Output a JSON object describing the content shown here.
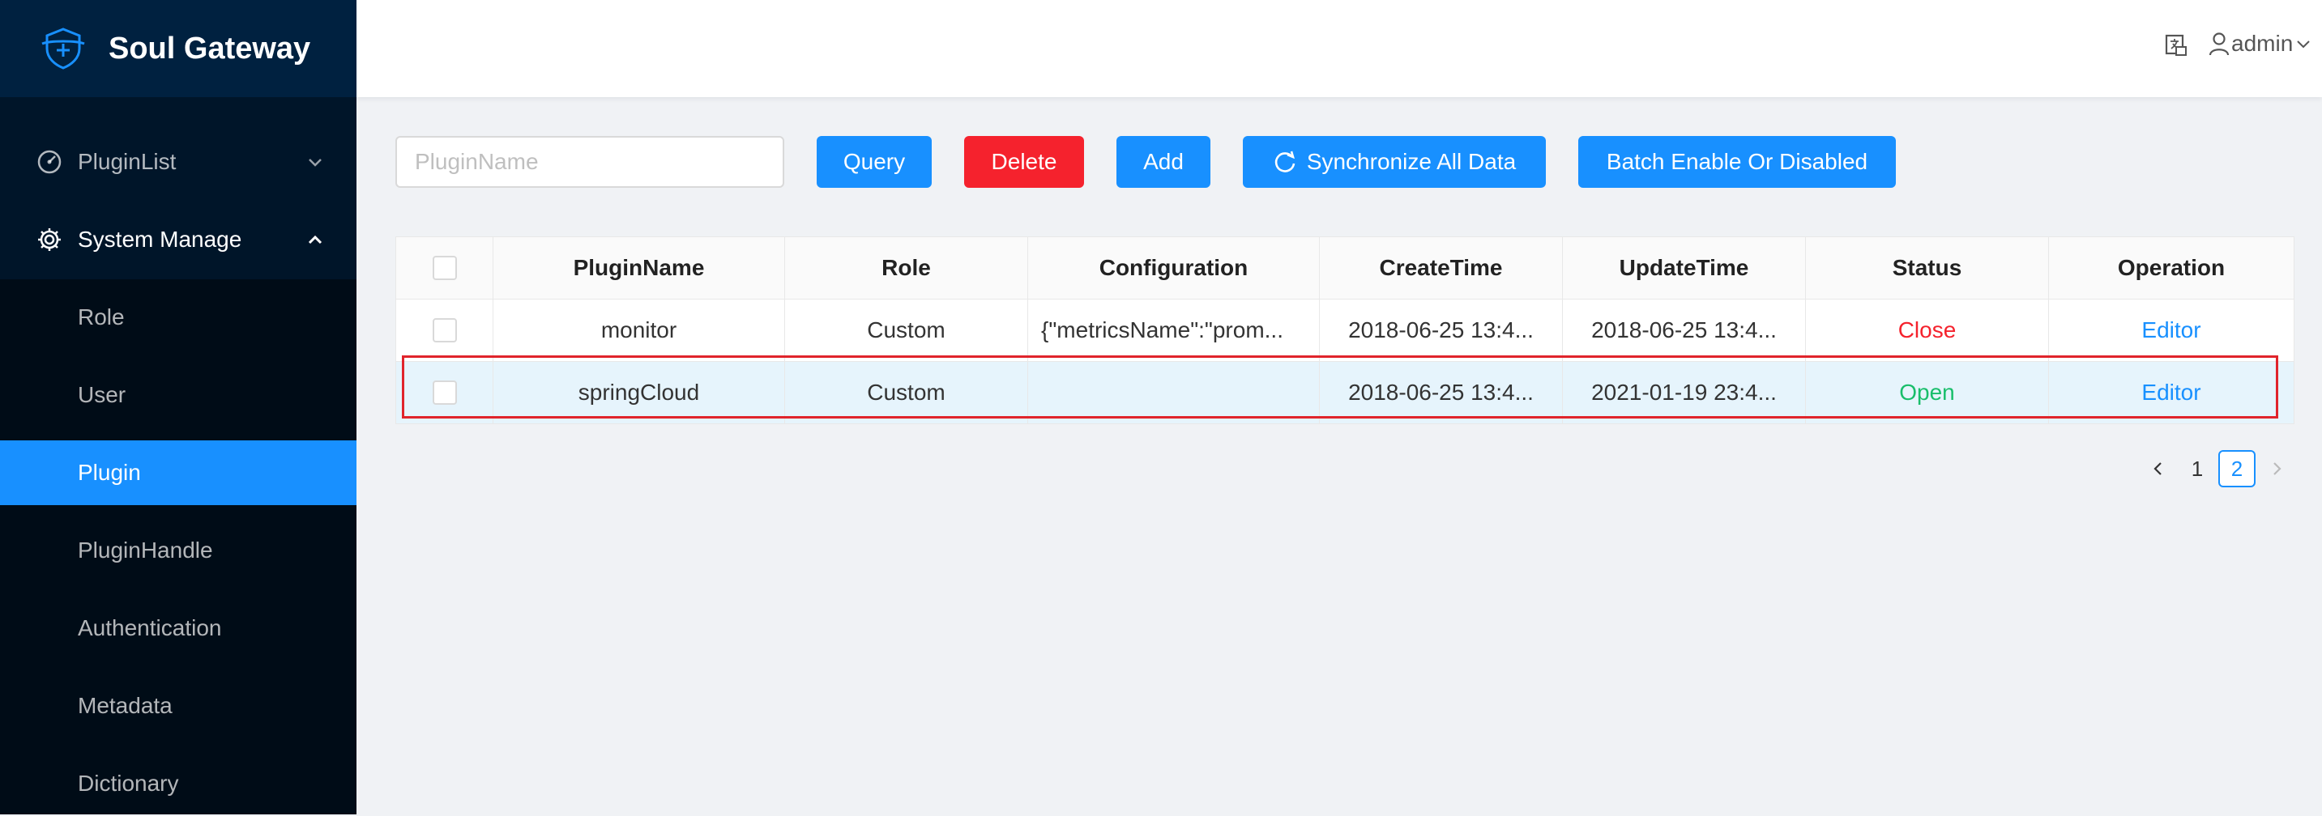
{
  "app": {
    "title": "Soul Gateway"
  },
  "sidebar": {
    "menus": [
      {
        "label": "PluginList",
        "icon": "dashboard-icon",
        "expanded": false
      },
      {
        "label": "System Manage",
        "icon": "gear-icon",
        "expanded": true
      }
    ],
    "subitems": [
      "Role",
      "User",
      "Plugin",
      "PluginHandle",
      "Authentication",
      "Metadata",
      "Dictionary"
    ],
    "active": "Plugin"
  },
  "header": {
    "user": "admin",
    "lang_icon": "language-icon"
  },
  "toolbar": {
    "search_placeholder": "PluginName",
    "search_value": "",
    "query": "Query",
    "delete": "Delete",
    "add": "Add",
    "sync": "Synchronize All Data",
    "batch": "Batch Enable Or Disabled"
  },
  "table": {
    "columns": [
      "PluginName",
      "Role",
      "Configuration",
      "CreateTime",
      "UpdateTime",
      "Status",
      "Operation"
    ],
    "rows": [
      {
        "name": "monitor",
        "role": "Custom",
        "config": "{\"metricsName\":\"prom...",
        "create": "2018-06-25 13:4...",
        "update": "2018-06-25 13:4...",
        "status": "Close",
        "op": "Editor"
      },
      {
        "name": "springCloud",
        "role": "Custom",
        "config": "",
        "create": "2018-06-25 13:4...",
        "update": "2021-01-19 23:4...",
        "status": "Open",
        "op": "Editor"
      }
    ]
  },
  "pagination": {
    "pages": [
      "1",
      "2"
    ],
    "current": "2"
  },
  "colors": {
    "primary": "#1890ff",
    "danger": "#f5222d",
    "open": "#19be6b",
    "sidebar": "#001529",
    "highlight": "#e0242b"
  }
}
